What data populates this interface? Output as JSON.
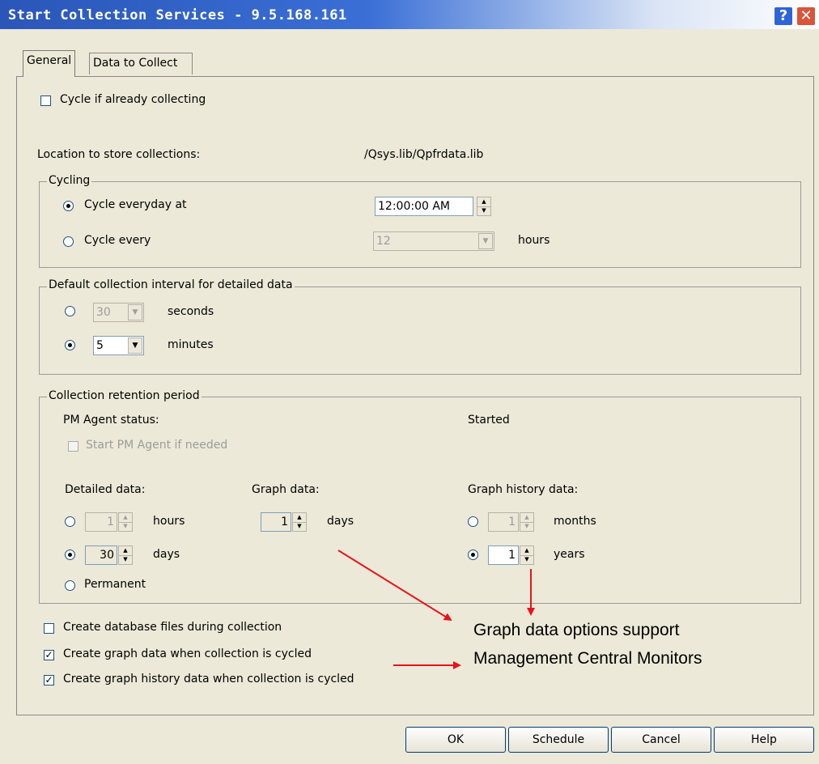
{
  "window": {
    "title": "Start Collection Services - 9.5.168.161"
  },
  "titlebar_buttons": {
    "help": "?",
    "close": "✕"
  },
  "tabs": [
    {
      "label": "General",
      "selected": true
    },
    {
      "label": "Data to Collect",
      "selected": false
    }
  ],
  "general": {
    "cycle_if_collecting": {
      "label": "Cycle if already collecting",
      "checked": false
    },
    "location_label": "Location to store collections:",
    "location_value": "/Qsys.lib/Qpfrdata.lib"
  },
  "cycling": {
    "legend": "Cycling",
    "everyday": {
      "label": "Cycle everyday at",
      "selected": true,
      "value": "12:00:00 AM"
    },
    "every": {
      "label": "Cycle every",
      "selected": false,
      "value": "12",
      "unit": "hours"
    }
  },
  "interval": {
    "legend": "Default collection interval for detailed data",
    "seconds": {
      "value": "30",
      "unit": "seconds",
      "selected": false
    },
    "minutes": {
      "value": "5",
      "unit": "minutes",
      "selected": true
    }
  },
  "retention": {
    "legend": "Collection retention period",
    "pm_status_label": "PM Agent status:",
    "pm_status_value": "Started",
    "start_pm_agent": {
      "label": "Start PM Agent if needed",
      "checked": false,
      "enabled": false
    },
    "detailed": {
      "label": "Detailed data:",
      "hours": {
        "value": "1",
        "unit": "hours",
        "selected": false
      },
      "days": {
        "value": "30",
        "unit": "days",
        "selected": true
      },
      "permanent": {
        "label": "Permanent",
        "selected": false
      }
    },
    "graph": {
      "label": "Graph data:",
      "value": "1",
      "unit": "days"
    },
    "history": {
      "label": "Graph history data:",
      "months": {
        "value": "1",
        "unit": "months",
        "selected": false
      },
      "years": {
        "value": "1",
        "unit": "years",
        "selected": true
      }
    }
  },
  "options": [
    {
      "label": "Create database files during collection",
      "checked": false
    },
    {
      "label": "Create graph data when collection is cycled",
      "checked": true
    },
    {
      "label": "Create graph history data when collection is cycled",
      "checked": true
    }
  ],
  "callout": {
    "line1": "Graph data options support",
    "line2": "Management Central Monitors",
    "arrow_color": "#e8141c"
  },
  "buttons": {
    "ok": "OK",
    "schedule": "Schedule",
    "cancel": "Cancel",
    "help": "Help"
  },
  "glyphs": {
    "check": "✓",
    "dropdown": "▼",
    "spin_up": "▲",
    "spin_down": "▼"
  },
  "colors": {
    "title_blue": "#2a56b8",
    "close_red": "#d8553a",
    "face": "#ece9d8"
  }
}
